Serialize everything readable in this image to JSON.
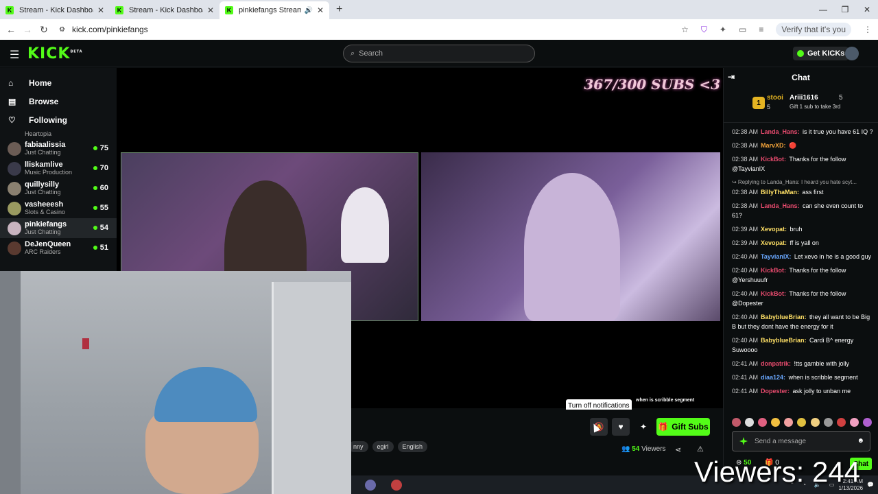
{
  "browser": {
    "tabs": [
      {
        "title": "Stream - Kick Dashboard"
      },
      {
        "title": "Stream - Kick Dashboard"
      },
      {
        "title": "pinkiefangs Stream - Watch"
      }
    ],
    "new_tab": "+",
    "url": "kick.com/pinkiefangs",
    "verify_label": "Verify that it's you",
    "window_controls": [
      "—",
      "❐",
      "✕"
    ]
  },
  "topnav": {
    "logo": "KICK",
    "logo_badge": "BETA",
    "search_placeholder": "Search",
    "get_kicks_label": "Get KICKs"
  },
  "sidebar": {
    "main": [
      {
        "label": "Home",
        "icon": "home-icon"
      },
      {
        "label": "Browse",
        "icon": "browse-icon"
      },
      {
        "label": "Following",
        "icon": "heart-icon"
      }
    ],
    "partial_category": "Heartopia",
    "channels": [
      {
        "name": "fabiaalissia",
        "category": "Just Chatting",
        "viewers": "75"
      },
      {
        "name": "lliskamlive",
        "category": "Music Production",
        "viewers": "70"
      },
      {
        "name": "quillysilly",
        "category": "Just Chatting",
        "viewers": "60"
      },
      {
        "name": "vasheeesh",
        "category": "Slots & Casino",
        "viewers": "55"
      },
      {
        "name": "pinkiefangs",
        "category": "Just Chatting",
        "viewers": "54"
      },
      {
        "name": "DeJenQueen",
        "category": "ARC Raiders",
        "viewers": "51"
      }
    ]
  },
  "player": {
    "subs_banner": "367/300 SUBS <3",
    "scribble_text": "when is scribble segment",
    "tooltip": "Turn off notifications",
    "gift_subs_label": "Gift Subs",
    "tags": [
      "nny",
      "egirl",
      "English"
    ],
    "viewers_count": "54",
    "viewers_label": "Viewers"
  },
  "chat": {
    "title": "Chat",
    "leaderboard": {
      "rank": "1",
      "user1": "stooi",
      "user1_count": "5",
      "user2": "Ariii1616",
      "user2_count": "5",
      "gift_hint": "Gift 1 sub to take 3rd"
    },
    "messages": [
      {
        "time": "02:38 AM",
        "user": "Landa_Hans",
        "color": "#e84b6e",
        "text": "is it true you have 61 IQ ?"
      },
      {
        "time": "02:38 AM",
        "user": "MarvXD",
        "color": "#f2a33a",
        "text": "🔴"
      },
      {
        "time": "02:38 AM",
        "user": "KickBot",
        "color": "#e84b6e",
        "text": "Thanks for the follow @TayvianIX"
      },
      {
        "time": "02:38 AM",
        "user": "BillyThaMan",
        "color": "#ffe066",
        "text": "ass first",
        "reply": "Replying to Landa_Hans: I heard you hate scyt..."
      },
      {
        "time": "02:38 AM",
        "user": "Landa_Hans",
        "color": "#e84b6e",
        "text": "can she even count to 61?"
      },
      {
        "time": "02:39 AM",
        "user": "Xevopat",
        "color": "#ffe066",
        "text": "bruh"
      },
      {
        "time": "02:39 AM",
        "user": "Xevopat",
        "color": "#ffe066",
        "text": "ff is yall on"
      },
      {
        "time": "02:40 AM",
        "user": "TayvianIX",
        "color": "#6aa8ff",
        "text": "Let xevo in he is a good guy"
      },
      {
        "time": "02:40 AM",
        "user": "KickBot",
        "color": "#e84b6e",
        "text": "Thanks for the follow @Yershuuufr"
      },
      {
        "time": "02:40 AM",
        "user": "KickBot",
        "color": "#e84b6e",
        "text": "Thanks for the follow @Dopester"
      },
      {
        "time": "02:40 AM",
        "user": "BabyblueBrian",
        "color": "#ffe066",
        "text": "they all want to be Big B but they dont have the energy for it"
      },
      {
        "time": "02:40 AM",
        "user": "BabyblueBrian",
        "color": "#ffe066",
        "text": "Cardi B^ energy Suwoooo"
      },
      {
        "time": "02:41 AM",
        "user": "donpatrik",
        "color": "#e84b6e",
        "text": "!tts gamble with jolly"
      },
      {
        "time": "02:41 AM",
        "user": "diaa124",
        "color": "#6aa8ff",
        "text": "when is scribble segment"
      },
      {
        "time": "02:41 AM",
        "user": "Dopester",
        "color": "#e84b6e",
        "text": "ask jolly to unban me"
      }
    ],
    "input_placeholder": "Send a message",
    "points": "50",
    "gifts": "0",
    "send_label": "Chat"
  },
  "taskbar": {
    "time": "2:41 AM",
    "date": "1/13/2026"
  },
  "overlay": {
    "viewers_text": "Viewers: 244"
  }
}
